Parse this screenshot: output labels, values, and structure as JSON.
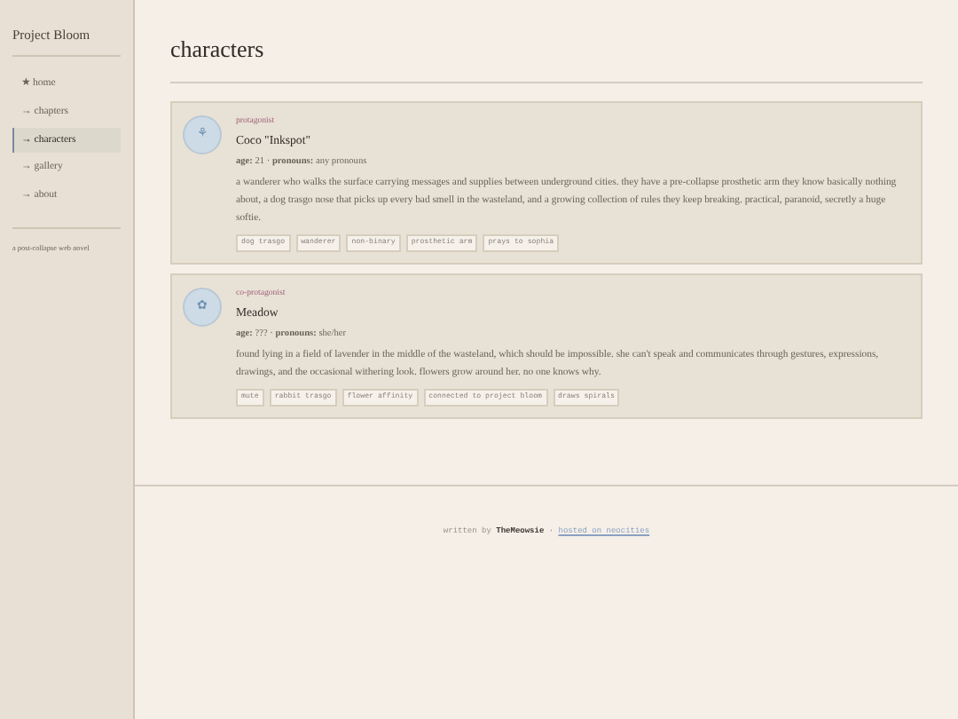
{
  "site_title": "Project Bloom",
  "nav": [
    {
      "marker": "★",
      "label": "home",
      "selected": false
    },
    {
      "marker": "→",
      "label": "chapters",
      "selected": false
    },
    {
      "marker": "→",
      "label": "characters",
      "selected": true
    },
    {
      "marker": "→",
      "label": "gallery",
      "selected": false
    },
    {
      "marker": "→",
      "label": "about",
      "selected": false
    }
  ],
  "tagline": "a post-collapse web novel",
  "page_title": "characters",
  "characters": [
    {
      "role": "protagonist",
      "symbol": "⚘",
      "name": "Coco \"Inkspot\"",
      "age_label": "age:",
      "age": "21",
      "meta_separator": "·",
      "pronouns_label": "pronouns:",
      "pronouns": "any pronouns",
      "description": "a wanderer who walks the surface carrying messages and supplies between underground cities. they have a pre-collapse prosthetic arm they know basically nothing about, a dog trasgo nose that picks up every bad smell in the wasteland, and a growing collection of rules they keep breaking. practical, paranoid, secretly a huge softie.",
      "tags": [
        "dog trasgo",
        "wanderer",
        "non-binary",
        "prosthetic arm",
        "prays to sophia"
      ]
    },
    {
      "role": "co-protagonist",
      "symbol": "✿",
      "name": "Meadow",
      "age_label": "age:",
      "age": "???",
      "meta_separator": "·",
      "pronouns_label": "pronouns:",
      "pronouns": "she/her",
      "description": "found lying in a field of lavender in the middle of the wasteland, which should be impossible. she can't speak and communicates through gestures, expressions, drawings, and the occasional withering look. flowers grow around her. no one knows why.",
      "tags": [
        "mute",
        "rabbit trasgo",
        "flower affinity",
        "connected to project bloom",
        "draws spirals"
      ]
    }
  ],
  "footer": {
    "prefix": "written by",
    "author": "TheMeowsie",
    "separator": "·",
    "link": "hosted on neocities"
  }
}
